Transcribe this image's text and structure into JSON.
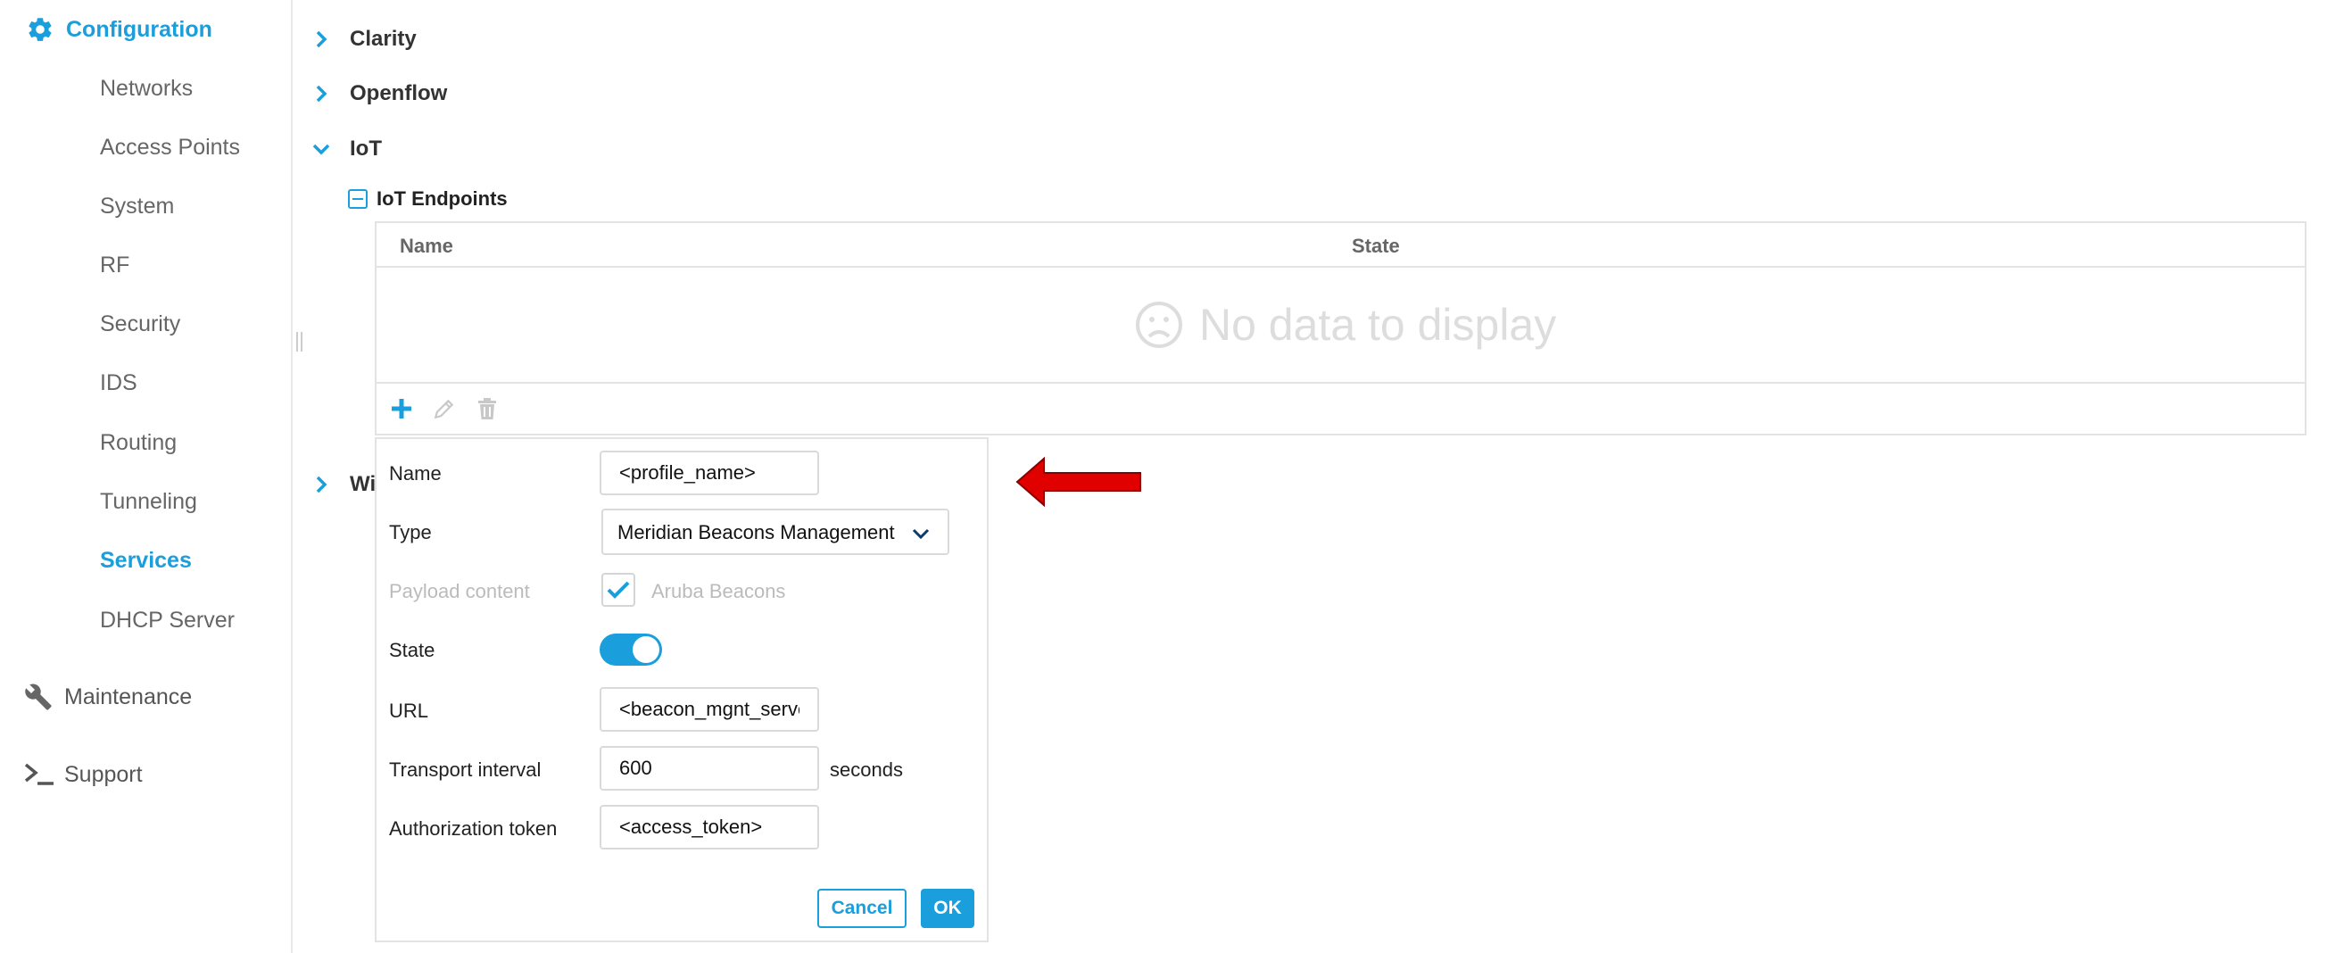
{
  "sidebar": {
    "configuration": "Configuration",
    "items": [
      {
        "label": "Networks"
      },
      {
        "label": "Access Points"
      },
      {
        "label": "System"
      },
      {
        "label": "RF"
      },
      {
        "label": "Security"
      },
      {
        "label": "IDS"
      },
      {
        "label": "Routing"
      },
      {
        "label": "Tunneling"
      },
      {
        "label": "Services",
        "active": true
      },
      {
        "label": "DHCP Server"
      }
    ],
    "maintenance": "Maintenance",
    "support": "Support"
  },
  "main": {
    "sections": [
      "Clarity",
      "Openflow",
      "IoT",
      "Wi"
    ],
    "expanded_section": "IoT",
    "iot_endpoints": {
      "title": "IoT Endpoints",
      "columns": [
        "Name",
        "State"
      ],
      "empty_text": "No data to display"
    }
  },
  "form": {
    "name_label": "Name",
    "name_value": "<profile_name>",
    "type_label": "Type",
    "type_value": "Meridian Beacons Management",
    "payload_label": "Payload content",
    "payload_option": "Aruba Beacons",
    "payload_checked": true,
    "state_label": "State",
    "state_on": true,
    "url_label": "URL",
    "url_value": "<beacon_mgnt_server_url>",
    "interval_label": "Transport interval",
    "interval_value": "600",
    "interval_unit": "seconds",
    "token_label": "Authorization token",
    "token_value": "<access_token>",
    "cancel_label": "Cancel",
    "ok_label": "OK"
  },
  "colors": {
    "accent": "#1a9fdc",
    "annotation_arrow": "#e00000"
  },
  "icons": {
    "configuration": "gear-icon",
    "maintenance": "wrench-icon",
    "support": "terminal-prompt-icon",
    "add": "plus-icon",
    "edit": "pencil-icon",
    "delete": "trash-icon",
    "empty": "sad-face-icon"
  }
}
